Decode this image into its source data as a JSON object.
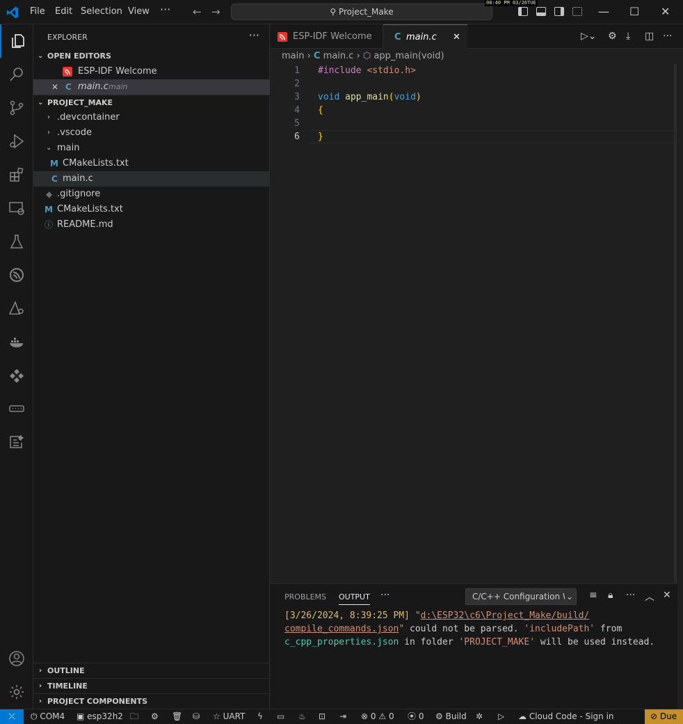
{
  "titlebar": {
    "menu": [
      "File",
      "Edit",
      "Selection",
      "View"
    ],
    "more": "···",
    "search_text": "Project_Make",
    "clock_time": "08:40 PM",
    "clock_date": "03/26TUE"
  },
  "explorer": {
    "title": "EXPLORER",
    "more": "···",
    "open_editors_label": "OPEN EDITORS",
    "open_editors": [
      {
        "name": "ESP-IDF Welcome"
      },
      {
        "name": "main.c",
        "hint": "main"
      }
    ],
    "project_label": "PROJECT_MAKE",
    "tree": [
      {
        "name": ".devcontainer"
      },
      {
        "name": ".vscode"
      },
      {
        "name": "main"
      },
      {
        "name": "CMakeLists.txt"
      },
      {
        "name": "main.c"
      },
      {
        "name": ".gitignore"
      },
      {
        "name": "CMakeLists.txt"
      },
      {
        "name": "README.md"
      }
    ],
    "outline": "OUTLINE",
    "timeline": "TIMELINE",
    "components": "PROJECT COMPONENTS"
  },
  "tabs": [
    {
      "label": "ESP-IDF Welcome"
    },
    {
      "label": "main.c"
    }
  ],
  "breadcrumb": {
    "folder": "main",
    "file": "main.c",
    "symbol": "app_main(void)"
  },
  "code": {
    "line_numbers": [
      "1",
      "2",
      "3",
      "4",
      "5",
      "6"
    ],
    "include_kw": "#include",
    "include_hdr": "<stdio.h>",
    "void1": "void",
    "fn_name": "app_main",
    "paren_open": "(",
    "void2": "void",
    "paren_close": ")",
    "brace_open": "{",
    "brace_close": "}"
  },
  "panel": {
    "tabs": [
      "PROBLEMS",
      "OUTPUT"
    ],
    "more": "···",
    "channel": "C/C++ Configuration W",
    "output": {
      "timestamp": "[3/26/2024, 8:39:25 PM]",
      "q1": "\"",
      "path1": "d:\\ESP32\\c6\\Project_Make/build/",
      "path2": "compile_commands.json",
      "q2": "\"",
      "msg1": " could not be parsed. ",
      "include_path": "'includePath'",
      "msg2": " from",
      "file": "c_cpp_properties.json",
      "msg3": " in folder ",
      "folder": "'PROJECT_MAKE'",
      "msg4": " will be used instead."
    }
  },
  "statusbar": {
    "port": "COM4",
    "target": "esp32h2",
    "flash_method": "UART",
    "errors": "0",
    "warnings": "0",
    "ports": "0",
    "build": "Build",
    "cloud": "Cloud Code - Sign in",
    "due": "Due"
  },
  "colors": {
    "accent": "#0078d4",
    "due": "#c69026",
    "esp_icon": "#e7352c",
    "c_icon": "#519aba"
  }
}
